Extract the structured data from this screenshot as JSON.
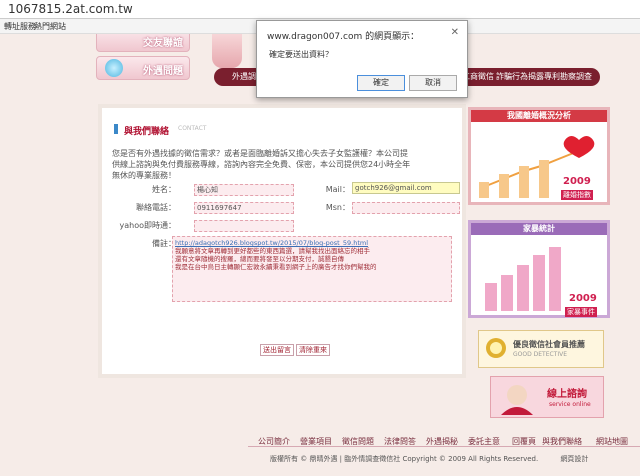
{
  "browser": {
    "url": "1067815.2at.com.tw",
    "bookmarks": [
      "轉址服務",
      "熱門網站"
    ]
  },
  "site": {
    "side_buttons": [
      "交友聯誼",
      "外遇問題"
    ],
    "nav": [
      "外遇調查",
      "工商徵信",
      "詐騙行為揭露",
      "專利勘察調查"
    ],
    "contact": {
      "title": "與我們聯絡",
      "title_en": "CONTACT",
      "intro": "您是否有外遇找據的徵信需求？或者是面臨離婚訴又擔心失去子女監護權？本公司提供線上諮詢與免付費服務專線，諮詢內容完全免費、保密，本公司提供您24小時全年無休的專業服務！",
      "labels": {
        "name": "姓名：",
        "mail": "Mail：",
        "phone": "聯絡電話：",
        "msn": "Msn：",
        "yahoo": "yahoo即時通：",
        "memo": "備註："
      },
      "values": {
        "name": "楊心知",
        "mail": "gotch926@gmail.com",
        "phone": "0911697647",
        "msn": "",
        "yahoo": "",
        "memo_link": "http://adagotch926.blogspot.tw/2015/07/blog-post_59.html",
        "memo_lines": [
          "我願意將文章再轉到更好都些的東西篇選，請幫我找出面絡忘的相手",
          "還有文章隨機的搜羅，總而要將發至以分期支付，誠懇自傳",
          "我是在台中烏日主轉顯仁宏敦永續秉看到網子上的廣告才找你們幫我的"
        ]
      },
      "submit_label": "送出留言",
      "clear_label": "清除重來"
    },
    "sidebar": {
      "analysis_title": "我國離婚概況分析",
      "analysis_year": "2009",
      "analysis_badge": "離婚指數",
      "stats_title": "家暴統計",
      "stats_year": "2009",
      "stats_badge": "家暴事件",
      "member_title": "優良徵信社會員推薦",
      "member_sub": "GOOD DETECTIVE",
      "online_title": "線上諮詢",
      "online_sub": "service online"
    },
    "footer": {
      "links": [
        "公司簡介",
        "營業項目",
        "徵信問題",
        "法律問答",
        "外遇揭秘",
        "委託主意",
        "回覆頁",
        "與我們聯絡",
        "網站地圖"
      ],
      "copyright": "版權所有 © 鼎晴外遇 | 臨外情調查徵信社 Copyright © 2009 All Rights Reserved.",
      "design": "網頁設計"
    }
  },
  "dialog": {
    "title": "www.dragon007.com 的網頁顯示：",
    "message": "確定要送出資料？",
    "ok_label": "確定",
    "cancel_label": "取消"
  }
}
